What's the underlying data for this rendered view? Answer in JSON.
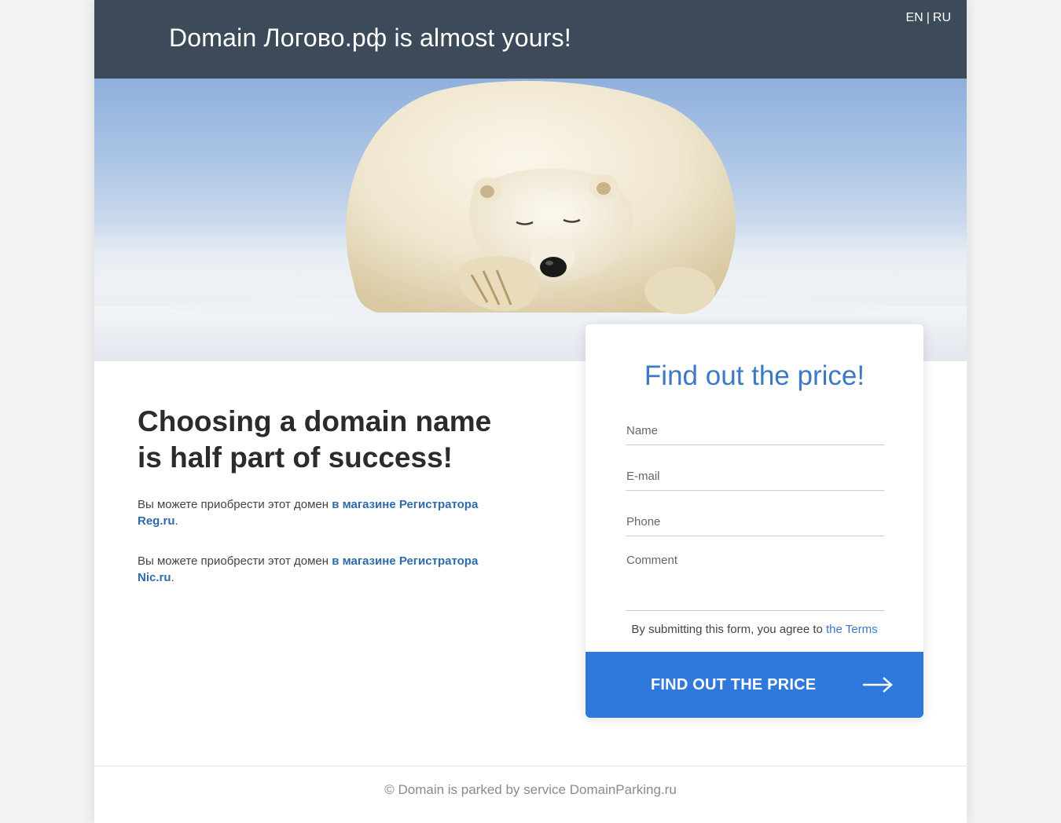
{
  "header": {
    "title": "Domain Логово.рф is almost yours!",
    "lang": {
      "en": "EN",
      "separator": "|",
      "ru": "RU"
    }
  },
  "hero": {
    "image": "polar-bear-sleeping-on-snow"
  },
  "main": {
    "headline_line1": "Choosing a domain name",
    "headline_line2": "is half part of success!",
    "offers": [
      {
        "text": "Вы можете приобрести этот домен ",
        "link_line1": "в магазине Регистратора",
        "link_line2": "Reg.ru",
        "suffix": "."
      },
      {
        "text": "Вы можете приобрести этот домен ",
        "link_line1": "в магазине Регистратора",
        "link_line2": "Nic.ru",
        "suffix": "."
      }
    ]
  },
  "form": {
    "title": "Find out the price!",
    "name_placeholder": "Name",
    "email_placeholder": "E-mail",
    "phone_placeholder": "Phone",
    "comment_placeholder": "Comment",
    "terms_text": "By submitting this form, you agree to ",
    "terms_link": "the Terms",
    "submit_label": "FIND OUT THE PRICE",
    "submit_icon": "arrow-right-icon"
  },
  "footer": {
    "text": "© Domain is parked by service DomainParking.ru"
  },
  "colors": {
    "header_bg": "#3d4a5a",
    "accent": "#3b79c4",
    "button_bg": "#2f78dc",
    "link": "#2f6bab"
  }
}
